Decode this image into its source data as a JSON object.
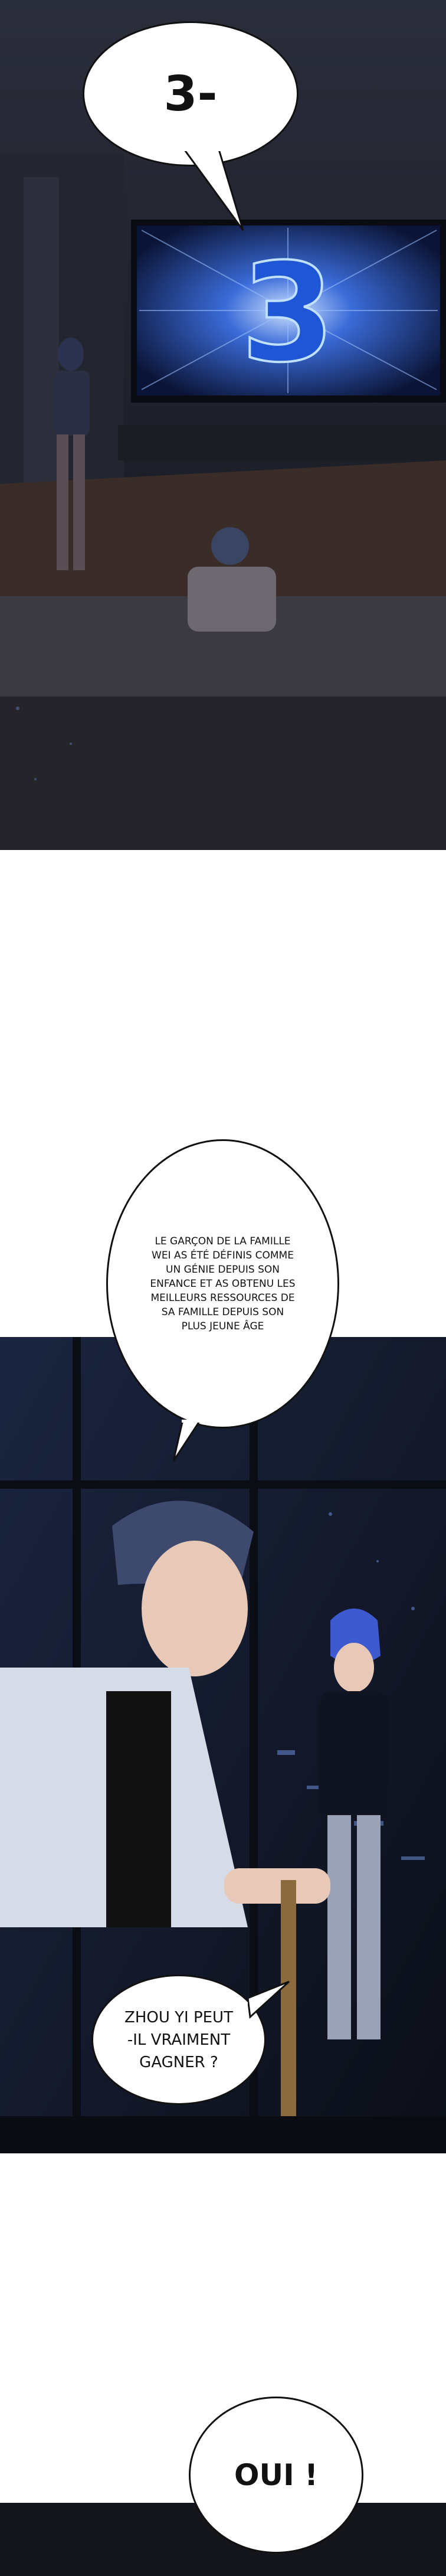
{
  "panels": [
    {
      "id": "panel-tv-countdown",
      "bubbles": [
        {
          "text": "3-"
        }
      ],
      "tv_screen_text": "3"
    },
    {
      "id": "panel-father-and-son",
      "bubbles": [
        {
          "lines": [
            "LE GARÇON DE LA FAMILLE",
            "WEI AS ÉTÉ DÉFINIS COMME",
            "UN GÉNIE DEPUIS SON",
            "ENFANCE ET AS OBTENU LES",
            "MEILLEURS RESSOURCES DE",
            "SA FAMILLE DEPUIS SON",
            "PLUS JEUNE ÂGE"
          ]
        },
        {
          "lines": [
            "ZHOU YI PEUT",
            "-IL VRAIMENT",
            "GAGNER ?"
          ]
        }
      ]
    },
    {
      "id": "panel-final",
      "bubbles": [
        {
          "text": "OUI !"
        }
      ]
    }
  ],
  "colors": {
    "room_dark": "#1c1f2c",
    "tv_glow": "#3a6bd8",
    "night_blue": "#1b2540",
    "skin": "#e8c9b8",
    "hair": "#3d4a6e"
  }
}
